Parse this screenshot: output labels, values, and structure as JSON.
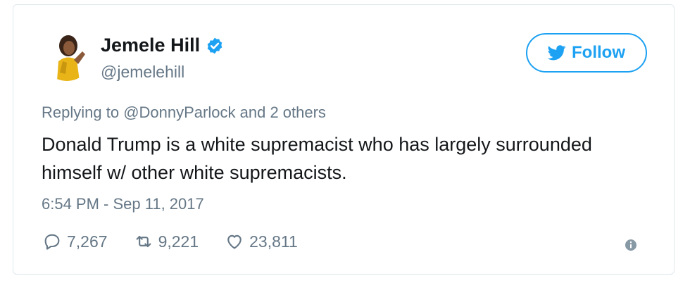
{
  "author": {
    "name": "Jemele Hill",
    "handle": "@jemelehill",
    "verified_icon": "verified-badge-icon"
  },
  "follow_button": {
    "label": "Follow",
    "icon": "twitter-bird-icon"
  },
  "tweet": {
    "reply_prefix": "Replying to",
    "reply_mention": "@DonnyParlock",
    "reply_suffix": "and 2 others",
    "text": "Donald Trump is a white supremacist who has largely surrounded himself w/ other white supremacists.",
    "timestamp": "6:54 PM - Sep 11, 2017"
  },
  "actions": {
    "replies": "7,267",
    "retweets": "9,221",
    "likes": "23,811"
  },
  "colors": {
    "accent": "#1da1f2",
    "muted": "#657786",
    "text": "#14171a"
  }
}
